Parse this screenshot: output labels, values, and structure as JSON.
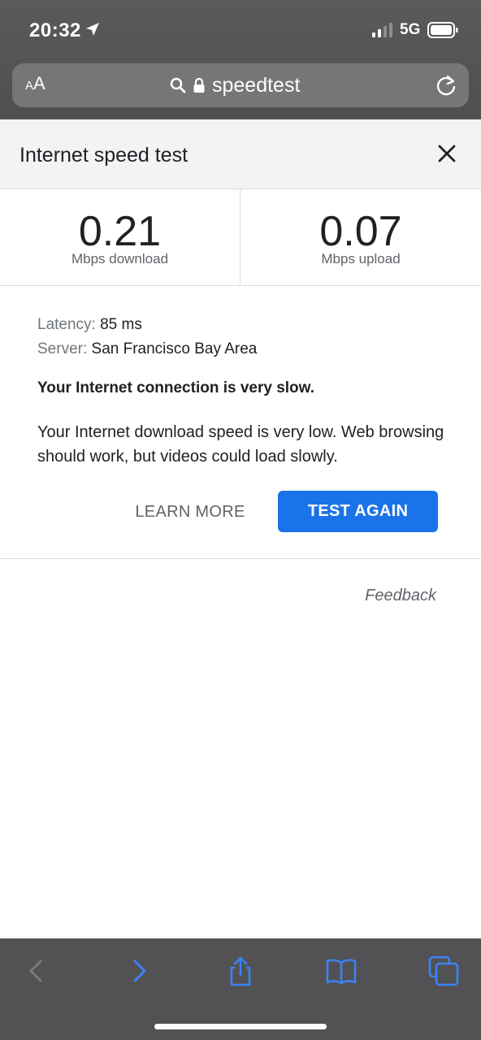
{
  "status_bar": {
    "time": "20:32",
    "network": "5G",
    "icons": [
      "location-arrow-icon",
      "signal-bars-icon",
      "battery-icon"
    ]
  },
  "browser": {
    "text_size_label_small": "A",
    "text_size_label_big": "A",
    "url": "speedtest",
    "icons": [
      "search-icon",
      "lock-icon",
      "reload-icon"
    ]
  },
  "speed_test": {
    "title": "Internet speed test",
    "download": {
      "value": "0.21",
      "label": "Mbps download"
    },
    "upload": {
      "value": "0.07",
      "label": "Mbps upload"
    },
    "latency_label": "Latency:",
    "latency_value": "85 ms",
    "server_label": "Server:",
    "server_value": "San Francisco Bay Area",
    "verdict": "Your Internet connection is very slow.",
    "explanation": "Your Internet download speed is very low. Web browsing should work, but videos could load slowly.",
    "learn_more_label": "LEARN MORE",
    "test_again_label": "TEST AGAIN",
    "feedback_label": "Feedback"
  },
  "toolbar": {
    "icons": [
      "back-icon",
      "forward-icon",
      "share-icon",
      "bookmarks-icon",
      "tabs-icon"
    ]
  },
  "colors": {
    "accent": "#1a73e8",
    "chrome": "#525254"
  }
}
